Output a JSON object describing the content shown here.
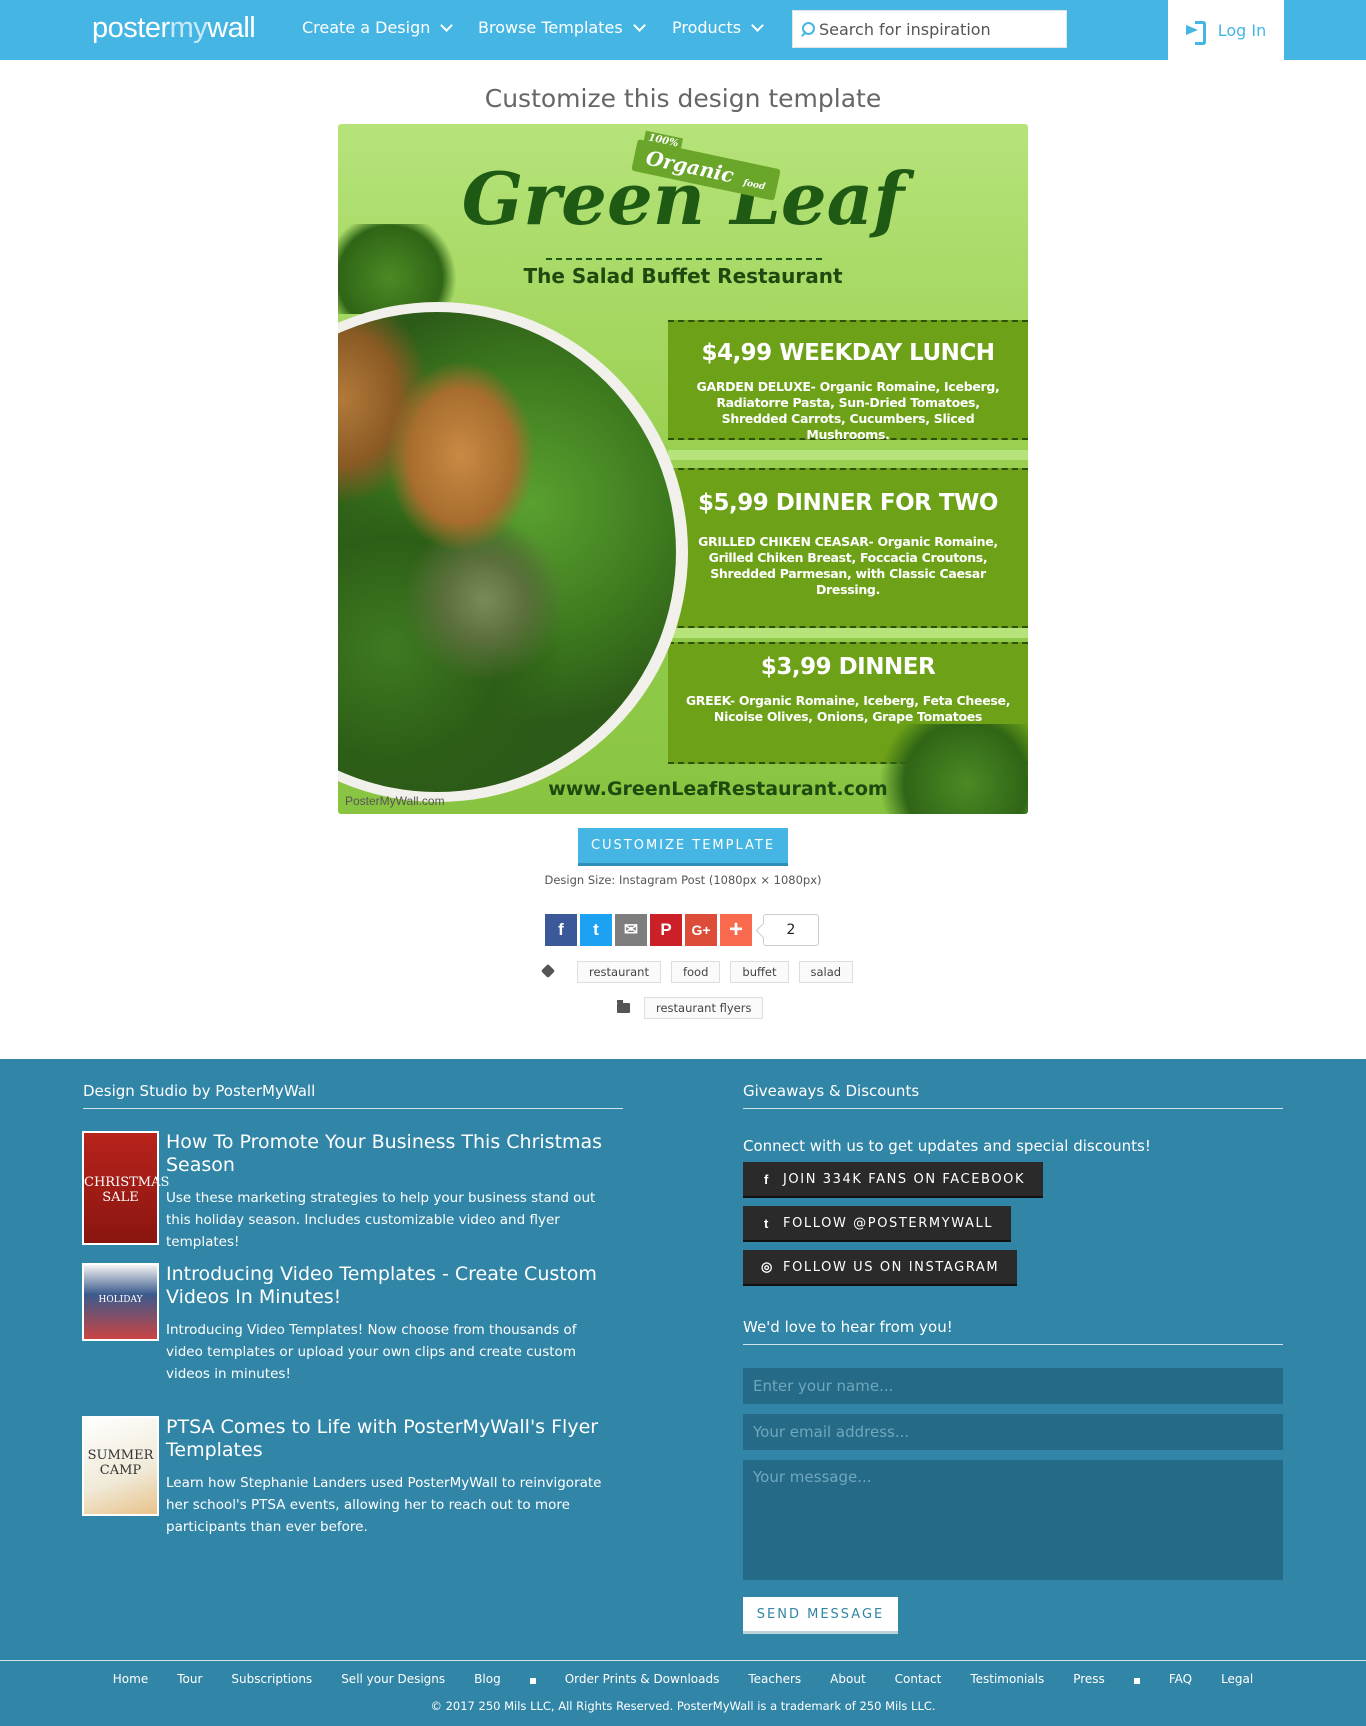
{
  "nav": {
    "logo_left": "poster",
    "logo_mid": "my",
    "logo_right": "wall",
    "items": [
      "Create a Design",
      "Browse Templates",
      "Products"
    ],
    "search_placeholder": "Search for inspiration",
    "login": "Log In"
  },
  "main": {
    "title": "Customize this design template",
    "poster": {
      "organic_top": "100%",
      "organic": "Organic",
      "organic_small": "food",
      "brand": "Green Leaf",
      "tagline": "The Salad Buffet Restaurant",
      "offers": [
        {
          "price": "$4,99 WEEKDAY LUNCH",
          "desc": "GARDEN DELUXE- Organic Romaine, Iceberg, Radiatorre Pasta, Sun-Dried Tomatoes, Shredded Carrots, Cucumbers, Sliced Mushrooms."
        },
        {
          "price": "$5,99 DINNER FOR TWO",
          "desc": "GRILLED CHIKEN CEASAR- Organic Romaine, Grilled Chiken Breast, Foccacia Croutons, Shredded Parmesan, with Classic Caesar Dressing."
        },
        {
          "price": "$3,99 DINNER",
          "desc": "GREEK- Organic Romaine, Iceberg, Feta Cheese, Nicoise Olives, Onions, Grape Tomatoes"
        }
      ],
      "url": "www.GreenLeafRestaurant.com",
      "watermark": "PosterMyWall.com"
    },
    "customize_label": "CUSTOMIZE TEMPLATE",
    "design_size": "Design Size: Instagram Post (1080px × 1080px)",
    "share_count": "2",
    "tags": [
      "restaurant",
      "food",
      "buffet",
      "salad"
    ],
    "category": "restaurant flyers"
  },
  "footer": {
    "left_heading": "Design Studio by PosterMyWall",
    "articles": [
      {
        "title": "How To Promote Your Business This Christmas Season",
        "desc": "Use these marketing strategies to help your business stand out this holiday season. Includes customizable video and flyer templates!",
        "thumb": "CHRISTMAS SALE"
      },
      {
        "title": "Introducing Video Templates - Create Custom Videos In Minutes!",
        "desc": "Introducing Video Templates! Now choose from thousands of video templates or upload your own clips and create custom videos in minutes!",
        "thumb": "HOLIDAY"
      },
      {
        "title": "PTSA Comes to Life with PosterMyWall's Flyer Templates",
        "desc": "Learn how Stephanie Landers used PosterMyWall to reinvigorate her school's PTSA events, allowing her to reach out to more participants than ever before.",
        "thumb": "SUMMER CAMP"
      }
    ],
    "right_heading": "Giveaways & Discounts",
    "connect": "Connect with us to get updates and special discounts!",
    "social": [
      "JOIN 334K FANS ON FACEBOOK",
      "FOLLOW @POSTERMYWALL",
      "FOLLOW US ON INSTAGRAM"
    ],
    "contact_heading": "We'd love to hear from you!",
    "name_placeholder": "Enter your name...",
    "email_placeholder": "Your email address...",
    "message_placeholder": "Your message...",
    "send_label": "SEND MESSAGE",
    "links": [
      "Home",
      "Tour",
      "Subscriptions",
      "Sell your Designs",
      "Blog",
      "Order Prints & Downloads",
      "Teachers",
      "About",
      "Contact",
      "Testimonials",
      "Press",
      "FAQ",
      "Legal"
    ],
    "copyright": "© 2017 250 Mils LLC, All Rights Reserved. PosterMyWall is a trademark of 250 Mils LLC."
  }
}
